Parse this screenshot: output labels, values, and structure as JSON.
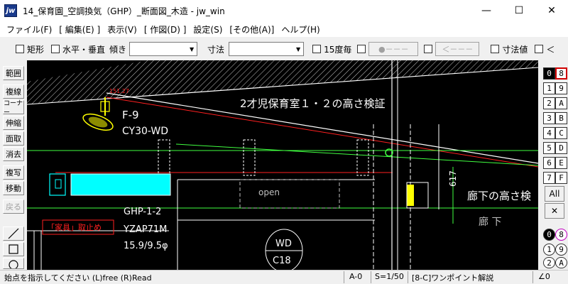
{
  "window": {
    "app_icon": "jw",
    "title": "14_保育園_空調換気（GHP）_断面図_木造 - jw_win",
    "minimize": "—",
    "maximize": "☐",
    "close": "✕"
  },
  "menu": [
    "ファイル(F)",
    "[ 編集(E) ]",
    "表示(V)",
    "[ 作図(D) ]",
    "設定(S)",
    "[その他(A)]",
    "ヘルプ(H)"
  ],
  "toolbar": {
    "rect": "矩形",
    "hv": "水平・垂直",
    "tilt_label": "傾き",
    "dim_label": "寸法",
    "deg15": "15度毎",
    "disabled_a": "●－－－",
    "disabled_b": "＜－－－",
    "dim_value": "寸法値",
    "lt": "＜"
  },
  "left_palette": [
    "範囲",
    "複線",
    "コーナー",
    "伸縮",
    "面取",
    "消去",
    "複写",
    "移動",
    "戻る"
  ],
  "right_palette": {
    "left_col": [
      "0",
      "1",
      "2",
      "3",
      "4",
      "5",
      "6",
      "7"
    ],
    "right_col": [
      "8",
      "9",
      "A",
      "B",
      "C",
      "D",
      "E",
      "F"
    ],
    "all": "All",
    "cross": "✕",
    "left_col2": [
      "0",
      "1",
      "2"
    ],
    "right_col2": [
      "8",
      "9",
      "A"
    ]
  },
  "drawing": {
    "dim_small": "151.27",
    "label_f9": "F-9",
    "label_cy": "CY30-WD",
    "title": "2才児保育室１・２の高さ検証",
    "corridor_title": "廊下の高さ検",
    "corridor": "廊 下",
    "open": "open",
    "ghp": "GHP-1-2",
    "yzap": "YZAP71M",
    "pipe": "15.9/9.5φ",
    "furniture": "「家具」取止め",
    "wd": "WD",
    "c18": "C18",
    "dim_617": "617"
  },
  "status": {
    "prompt": "始点を指示してください (L)free (R)Read",
    "layer": "A-0",
    "scale": "S=1/50",
    "onepoint": "[8-C]ワンポイント解説",
    "angle": "∠0"
  },
  "colors": {
    "canvas": "#000000",
    "white_line": "#ffffff",
    "red_line": "#ff2020",
    "green_line": "#40ff40",
    "cyan": "#00ffff",
    "yellow": "#ffff00"
  }
}
